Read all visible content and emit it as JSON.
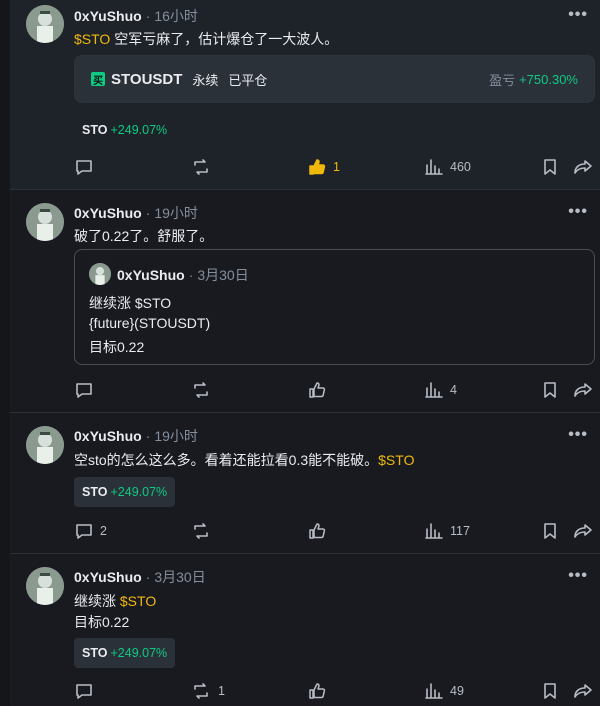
{
  "posts": [
    {
      "author": "0xYuShuo",
      "time": "16小时",
      "text_cashtag": "$STO",
      "text": " 空军亏麻了，估计爆仓了一大波人。",
      "trade": {
        "badge": "买",
        "pair": "STOUSDT",
        "type": "永续",
        "status": "已平仓",
        "pnl_label": "盈亏",
        "pnl_value": "+750.30%"
      },
      "chip": {
        "symbol": "STO",
        "change": "+249.07%"
      },
      "actions": {
        "comments": "",
        "reposts": "",
        "likes": "1",
        "views": "460"
      }
    },
    {
      "author": "0xYuShuo",
      "time": "19小时",
      "text": "破了0.22了。舒服了。",
      "quote": {
        "author": "0xYuShuo",
        "time": "3月30日",
        "lines": [
          "继续涨 $STO",
          "{future}(STOUSDT)",
          "目标0.22"
        ]
      },
      "actions": {
        "comments": "",
        "reposts": "",
        "likes": "",
        "views": "4"
      }
    },
    {
      "author": "0xYuShuo",
      "time": "19小时",
      "text": "空sto的怎么这么多。看着还能拉看0.3能不能破。",
      "text_cashtag": "$STO",
      "chip": {
        "symbol": "STO",
        "change": "+249.07%"
      },
      "actions": {
        "comments": "2",
        "reposts": "",
        "likes": "",
        "views": "117"
      }
    },
    {
      "author": "0xYuShuo",
      "time": "3月30日",
      "line1_prefix": "继续涨 ",
      "text_cashtag": "$STO",
      "line2": "目标0.22",
      "chip": {
        "symbol": "STO",
        "change": "+249.07%"
      },
      "actions": {
        "comments": "",
        "reposts": "1",
        "likes": "",
        "views": "49"
      }
    }
  ],
  "separator": "·",
  "more_glyph": "•••",
  "colors": {
    "background": "#181a20",
    "highlight": "#1e2329",
    "cashtag": "#f0b90b",
    "positive": "#0ecb81",
    "muted": "#848e9c"
  },
  "icons": [
    "comment-icon",
    "repost-icon",
    "like-icon",
    "views-icon",
    "bookmark-icon",
    "share-icon",
    "more-icon"
  ]
}
